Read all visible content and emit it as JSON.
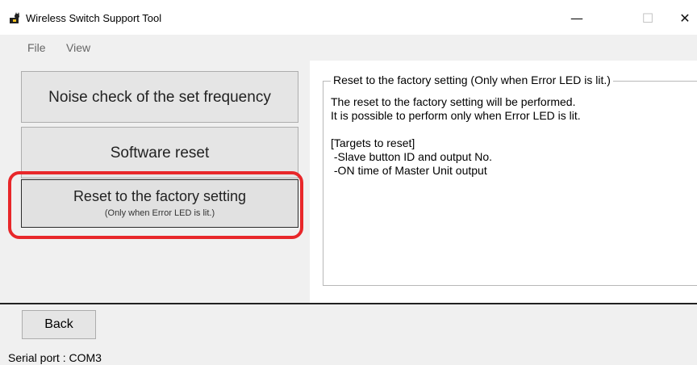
{
  "window": {
    "title": "Wireless Switch Support Tool",
    "app_icon": "cat-app-icon",
    "minimize_glyph": "—",
    "maximize_glyph": "☐",
    "close_glyph": "✕"
  },
  "menu": {
    "items": [
      {
        "label": "File"
      },
      {
        "label": "View"
      }
    ]
  },
  "buttons": {
    "noise_check": "Noise check of the set frequency",
    "software_reset": "Software reset",
    "factory_reset": "Reset to the factory setting",
    "factory_reset_sub": "(Only when Error LED is lit.)",
    "back": "Back"
  },
  "description": {
    "group_title": "Reset to the factory setting (Only when Error LED is lit.)",
    "text": "The reset to the factory setting will be performed.\nIt is possible to perform only when Error LED is lit.\n\n[Targets to reset]\n -Slave button ID and output No.\n -ON time of Master Unit output"
  },
  "status": {
    "serial_port": "Serial port :  COM3"
  },
  "colors": {
    "highlight": "#e8272a",
    "panel_bg": "#f0f0f0"
  }
}
